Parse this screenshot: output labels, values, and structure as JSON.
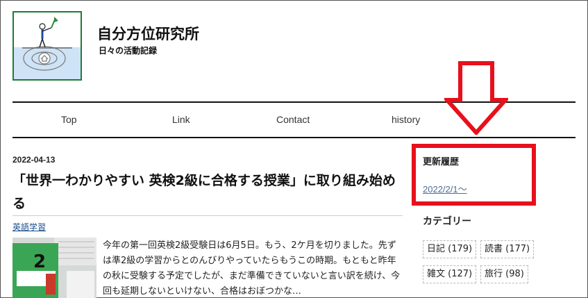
{
  "site": {
    "title": "自分方位研究所",
    "subtitle": "日々の活動記録"
  },
  "nav": {
    "items": [
      "Top",
      "Link",
      "Contact",
      "history"
    ]
  },
  "post": {
    "date": "2022-04-13",
    "title": "「世界一わかりやすい 英検2級に合格する授業」に取り組み始める",
    "category": "英語学習",
    "excerpt": "今年の第一回英検2級受験日は6月5日。もう、2ケ月を切りました。先ずは準2級の学習からとのんびりやっていたらもうこの時期。もともと昨年の秋に受験する予定でしたが、まだ準備できていないと言い訳を続け、今回も延期しないといけない、合格はおぼつかな…"
  },
  "sidebar": {
    "update_heading": "更新履歴",
    "update_link": "2022/2/1〜",
    "category_heading": "カテゴリー",
    "categories": [
      {
        "label": "日記 (179)"
      },
      {
        "label": "読書 (177)"
      },
      {
        "label": "雑文 (127)"
      },
      {
        "label": "旅行 (98)"
      }
    ]
  },
  "colors": {
    "highlight": "#e8101c",
    "logo_border": "#1e7a37",
    "link": "#4a6f96"
  }
}
